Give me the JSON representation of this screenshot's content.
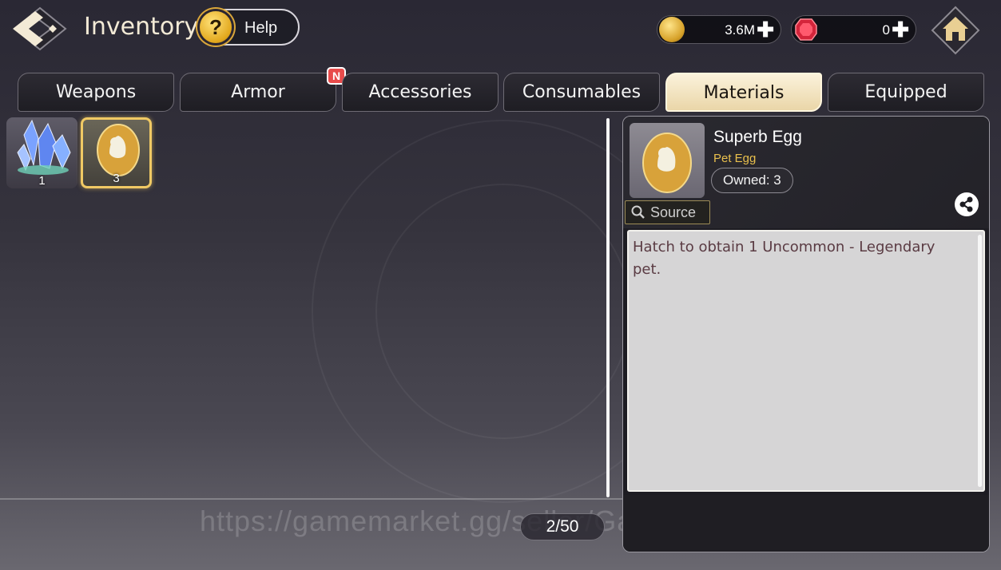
{
  "header": {
    "title": "Inventory",
    "help_label": "Help",
    "help_glyph": "?",
    "gold_amount": "3.6M",
    "gem_amount": "0",
    "plus_glyph": "✚"
  },
  "tabs": [
    {
      "label": "Weapons",
      "active": false
    },
    {
      "label": "Armor",
      "active": false,
      "badge": "N"
    },
    {
      "label": "Accessories",
      "active": false
    },
    {
      "label": "Consumables",
      "active": false
    },
    {
      "label": "Materials",
      "active": true
    },
    {
      "label": "Equipped",
      "active": false
    }
  ],
  "items": [
    {
      "name": "crystal",
      "icon": "crystal-icon",
      "quantity": "1",
      "selected": false
    },
    {
      "name": "superb-egg",
      "icon": "egg-icon",
      "quantity": "3",
      "selected": true
    }
  ],
  "pagination": {
    "label": "2/50"
  },
  "watermark": "https://gamemarket.gg/seller/GameNews",
  "detail": {
    "name": "Superb Egg",
    "type": "Pet Egg",
    "owned": "Owned: 3",
    "source_label": "Source",
    "description": "Hatch to obtain 1 Uncommon - Legendary pet."
  },
  "colors": {
    "accent_gold": "#e9c04d",
    "active_tab": "#f4e6c2",
    "badge_red": "#e84b4b",
    "description_text": "#5a3b43"
  }
}
